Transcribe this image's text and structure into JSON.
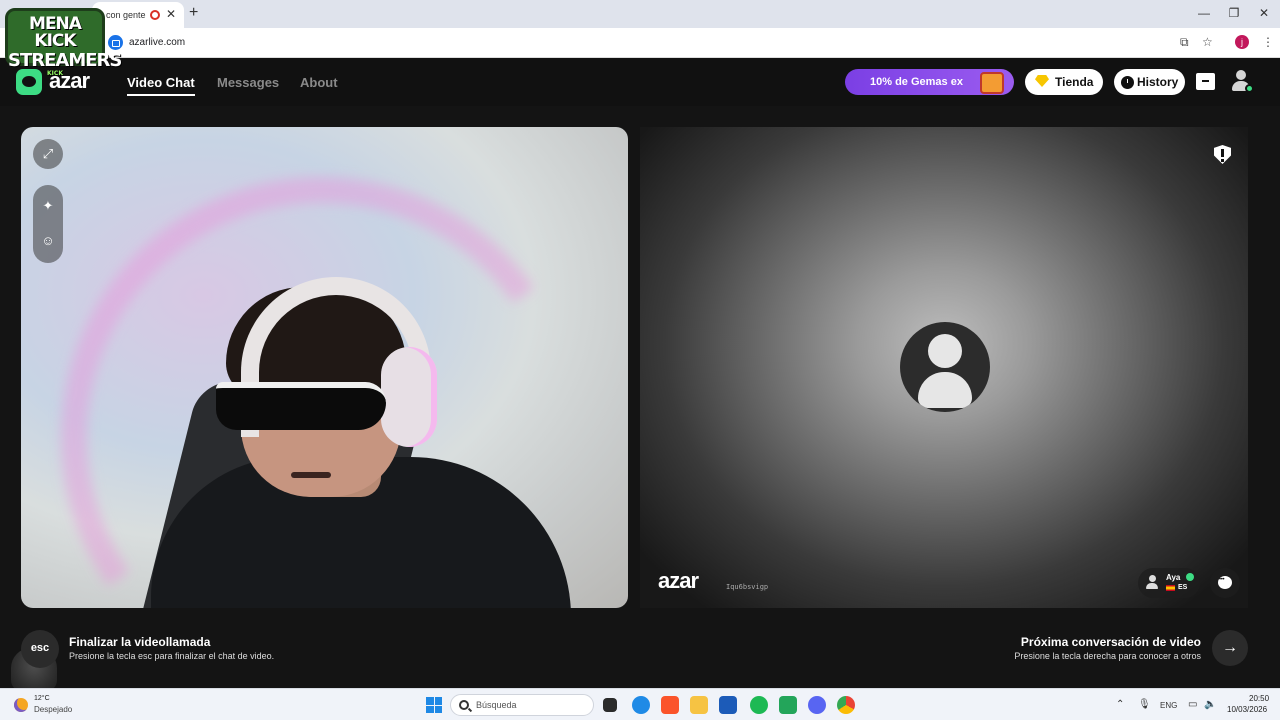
{
  "browser": {
    "tab_title": "con gente",
    "url": "azarlive.com",
    "profile_initial": "j"
  },
  "overlay_logo": {
    "line1": "MENA KICK",
    "line2": "STREAMERS",
    "line3": "KICK"
  },
  "header": {
    "logo_text": "azar",
    "nav": [
      "Video Chat",
      "Messages",
      "About"
    ],
    "active_nav": "Video Chat",
    "promo_text": "10% de Gemas ex",
    "shop_label": "Tienda",
    "history_label": "History"
  },
  "remote": {
    "watermark": "azar",
    "id": "Iqu6bsvigp",
    "partner_name": "Aya",
    "partner_lang": "ES"
  },
  "bottom": {
    "esc_label": "esc",
    "end_title": "Finalizar la videollamada",
    "end_subtitle": "Presione la tecla esc para finalizar el chat de video.",
    "next_title": "Próxima conversación de video",
    "next_subtitle": "Presione la tecla derecha para conocer a otros"
  },
  "taskbar": {
    "weather_temp": "12°C",
    "weather_desc": "Despejado",
    "search_placeholder": "Búsqueda",
    "lang": "ENG",
    "time": "20:50",
    "date": "10/03/2026"
  },
  "colors": {
    "accent_green": "#3ddc84",
    "promo_purple": "#7b3fe4",
    "background": "#141414"
  }
}
